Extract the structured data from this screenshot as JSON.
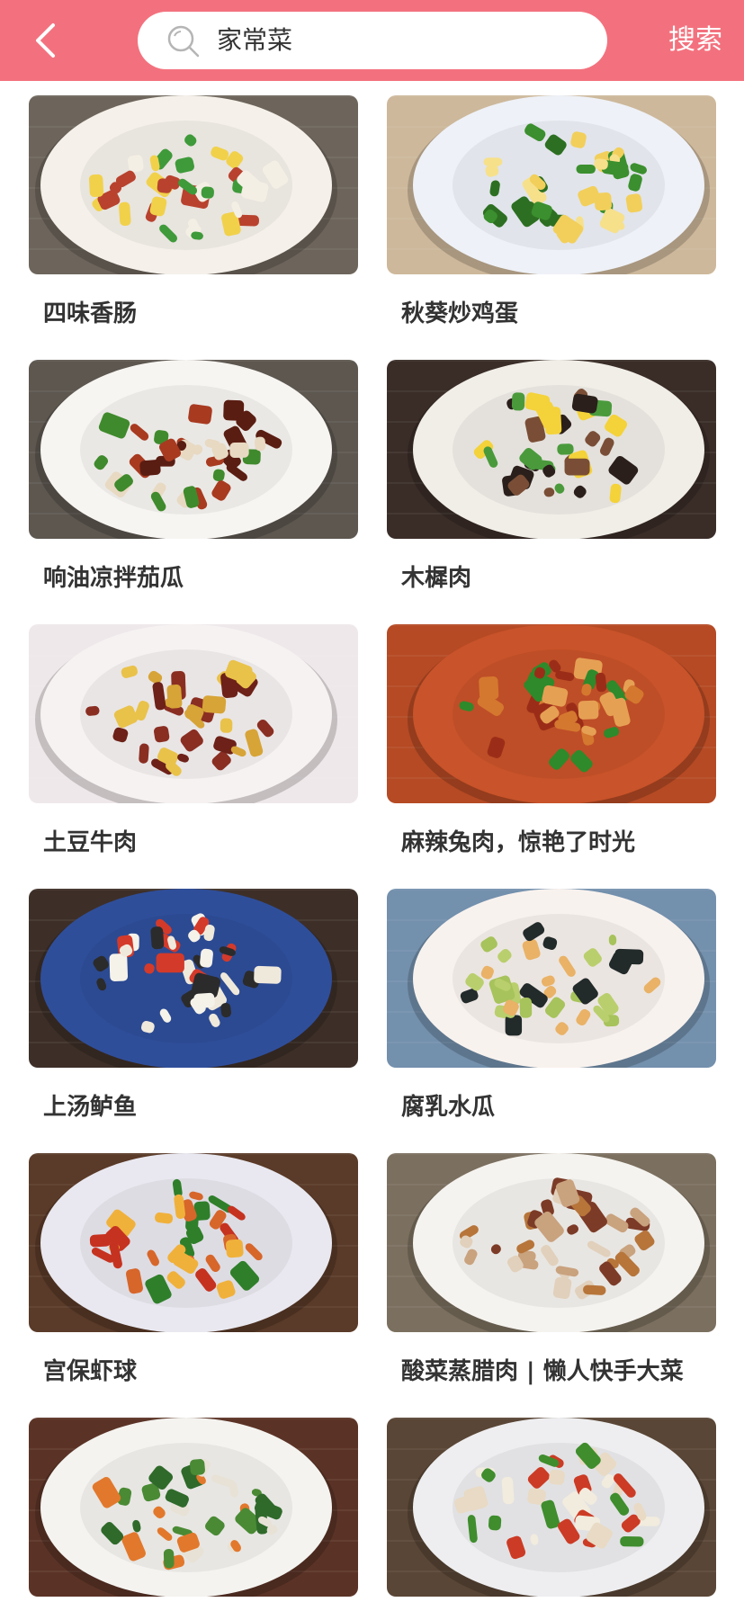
{
  "header": {
    "search_value": "家常菜",
    "search_button_label": "搜索"
  },
  "recipes": [
    {
      "title": "四味香肠",
      "bg": "#6d655c",
      "plate": "#f5f1ea",
      "food": [
        "#b8422e",
        "#f1d14a",
        "#3f9a3a",
        "#f4efe4"
      ]
    },
    {
      "title": "秋葵炒鸡蛋",
      "bg": "#cdb89b",
      "plate": "#eef1f7",
      "food": [
        "#f2cf5a",
        "#3b8f2e",
        "#f6e08a",
        "#2d6f22"
      ]
    },
    {
      "title": "响油凉拌茄瓜",
      "bg": "#5d5750",
      "plate": "#f7f5f2",
      "food": [
        "#5a1d12",
        "#e8d9c2",
        "#3f8a2c",
        "#a83a20"
      ]
    },
    {
      "title": "木樨肉",
      "bg": "#3a2d28",
      "plate": "#f1eee8",
      "food": [
        "#2a1f1b",
        "#f4d23a",
        "#4a9a3c",
        "#7a4e36"
      ]
    },
    {
      "title": "土豆牛肉",
      "bg": "#efe8ea",
      "plate": "#f6f2f2",
      "food": [
        "#e9c24a",
        "#8a2e22",
        "#d7a437",
        "#6d2118"
      ]
    },
    {
      "title": "麻辣兔肉，惊艳了时光",
      "bg": "#b54a24",
      "plate": "#c9532a",
      "food": [
        "#d4782f",
        "#2e8a2a",
        "#e6a054",
        "#9b2d18"
      ]
    },
    {
      "title": "上汤鲈鱼",
      "bg": "#3d2f28",
      "plate": "#2f4e9a",
      "food": [
        "#efe9dc",
        "#2b2b2b",
        "#d43a2a",
        "#f5f2ea"
      ]
    },
    {
      "title": "腐乳水瓜",
      "bg": "#7390ad",
      "plate": "#f8f2ee",
      "food": [
        "#b9cf6d",
        "#e9b266",
        "#a7c35b",
        "#222a2a"
      ]
    },
    {
      "title": "宫保虾球",
      "bg": "#5a3a28",
      "plate": "#e9e8f0",
      "food": [
        "#d7662a",
        "#f0b13b",
        "#2f7f2a",
        "#c63220"
      ]
    },
    {
      "title": "酸菜蒸腊肉 | 懒人快手大菜",
      "bg": "#7b6f5f",
      "plate": "#f5f3ef",
      "food": [
        "#7c3b27",
        "#c9a27e",
        "#e1d0bb",
        "#b7753a"
      ]
    },
    {
      "title": "",
      "bg": "#5b3326",
      "plate": "#f4f3f0",
      "food": [
        "#2f6a2a",
        "#e2782c",
        "#4a8a34",
        "#e8e2d6"
      ]
    },
    {
      "title": "",
      "bg": "#5a4636",
      "plate": "#eeeef0",
      "food": [
        "#e8dac4",
        "#cc3b25",
        "#3f8d2d",
        "#f2ecde"
      ]
    }
  ]
}
